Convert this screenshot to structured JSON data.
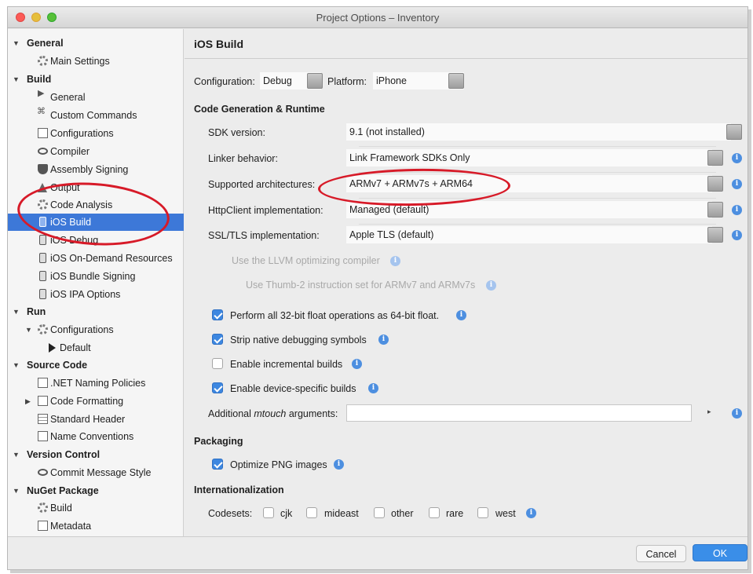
{
  "window": {
    "title": "Project Options – Inventory"
  },
  "sidebar": {
    "sections": {
      "general": "General",
      "build": "Build",
      "run": "Run",
      "source_code": "Source Code",
      "version_control": "Version Control",
      "nuget": "NuGet Package"
    },
    "items": {
      "main_settings": "Main Settings",
      "build_general": "General",
      "custom_commands": "Custom Commands",
      "configurations": "Configurations",
      "compiler": "Compiler",
      "assembly_signing": "Assembly Signing",
      "output": "Output",
      "code_analysis": "Code Analysis",
      "ios_build": "iOS Build",
      "ios_debug": "iOS Debug",
      "ios_odr": "iOS On-Demand Resources",
      "ios_bundle_signing": "iOS Bundle Signing",
      "ios_ipa": "iOS IPA Options",
      "run_configurations": "Configurations",
      "run_default": "Default",
      "net_naming": ".NET Naming Policies",
      "code_formatting": "Code Formatting",
      "standard_header": "Standard Header",
      "name_conventions": "Name Conventions",
      "commit_message_style": "Commit Message Style",
      "nuget_build": "Build",
      "nuget_metadata": "Metadata"
    },
    "selected": "iOS Build"
  },
  "main": {
    "title": "iOS Build",
    "configuration_label": "Configuration:",
    "configuration_value": "Debug",
    "platform_label": "Platform:",
    "platform_value": "iPhone",
    "codegen_heading": "Code Generation & Runtime",
    "rows": {
      "sdk_label": "SDK version:",
      "sdk_value": "9.1 (not installed)",
      "linker_label": "Linker behavior:",
      "linker_value": "Link Framework SDKs Only",
      "arch_label": "Supported architectures:",
      "arch_value": "ARMv7 + ARMv7s + ARM64",
      "http_label": "HttpClient implementation:",
      "http_value": "Managed (default)",
      "ssl_label": "SSL/TLS implementation:",
      "ssl_value": "Apple TLS (default)"
    },
    "disabled_options": {
      "llvm": "Use the LLVM optimizing compiler",
      "thumb": "Use Thumb-2 instruction set for ARMv7 and ARMv7s"
    },
    "checkboxes": {
      "float32": {
        "label": "Perform all 32-bit float operations as 64-bit float.",
        "checked": true
      },
      "strip": {
        "label": "Strip native debugging symbols",
        "checked": true
      },
      "incremental": {
        "label": "Enable incremental builds",
        "checked": false
      },
      "device_specific": {
        "label": "Enable device-specific builds",
        "checked": true
      }
    },
    "mtouch": {
      "label_prefix": "Additional ",
      "label_em": "mtouch",
      "label_suffix": " arguments:",
      "value": ""
    },
    "packaging_heading": "Packaging",
    "optimize_png": {
      "label": "Optimize PNG images",
      "checked": true
    },
    "i18n_heading": "Internationalization",
    "codesets_label": "Codesets:",
    "codesets": [
      "cjk",
      "mideast",
      "other",
      "rare",
      "west"
    ]
  },
  "footer": {
    "cancel": "Cancel",
    "ok": "OK"
  },
  "colors": {
    "selection": "#3d78d8",
    "ok_button": "#3a8ee8",
    "annotation_circle": "#d71a28",
    "checkbox_checked": "#3d87e0"
  }
}
